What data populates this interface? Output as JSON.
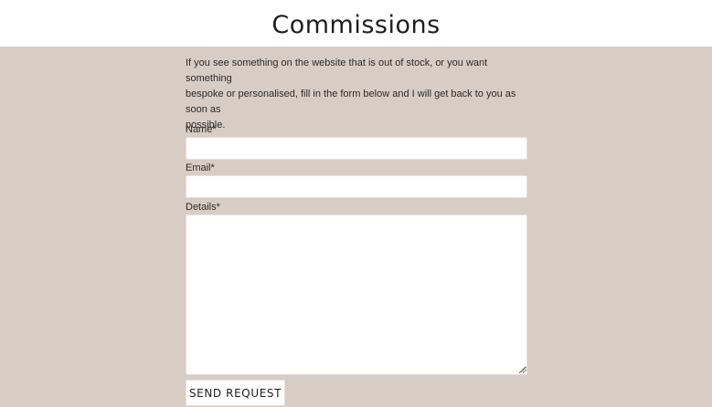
{
  "header": {
    "title": "Commissions"
  },
  "form": {
    "intro_line1": "If you see something on the website that is out of stock, or you want something",
    "intro_line2": "bespoke or personalised, fill in the form below and I will get back to you as soon as",
    "intro_line3": "possible.",
    "name_label": "Name*",
    "name_value": "",
    "email_label": "Email*",
    "email_value": "",
    "details_label": "Details*",
    "details_value": "",
    "submit_label": "SEND REQUEST"
  },
  "colors": {
    "page_background": "#d8cdc5",
    "header_background": "#ffffff",
    "input_background": "#ffffff"
  },
  "icons": [
    "textarea-resize-icon"
  ]
}
